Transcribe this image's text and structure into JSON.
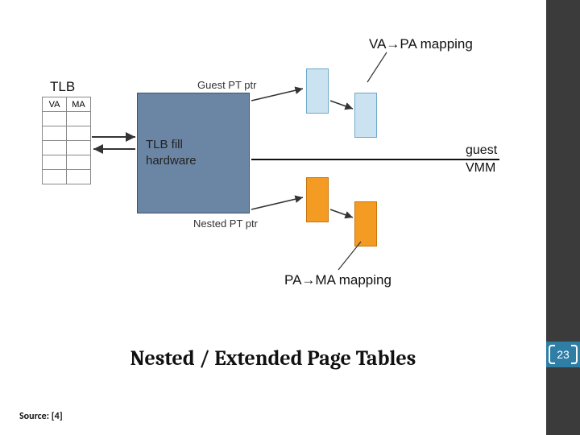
{
  "diagram": {
    "tlb_label": "TLB",
    "tlb_cols": {
      "left": "VA",
      "right": "MA"
    },
    "main_block": {
      "line1": "TLB fill",
      "line2": "hardware"
    },
    "ptr_labels": {
      "guest": "Guest PT ptr",
      "nested": "Nested PT ptr"
    },
    "map_labels": {
      "top": "VA→PA mapping",
      "bottom": "PA→MA mapping"
    },
    "side_labels": {
      "guest": "guest",
      "vmm": "VMM"
    }
  },
  "caption": "Nested / Extended Page Tables",
  "source": "Source: [4]",
  "page_number": "23"
}
